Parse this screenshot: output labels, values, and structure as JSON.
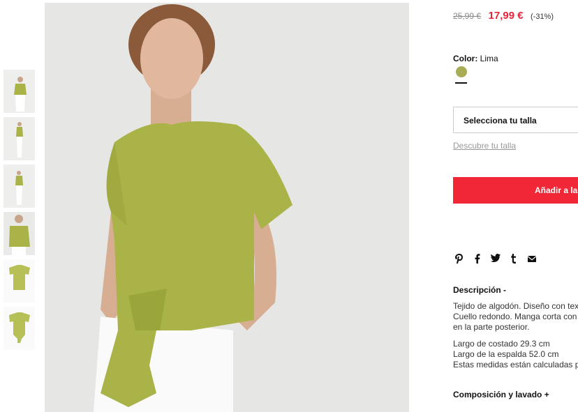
{
  "product": {
    "old_price": "25,99 €",
    "new_price": "17,99 €",
    "discount": "(-31%)",
    "color_label": "Color:",
    "color_value": "Lima",
    "swatch_color": "#a8ad54"
  },
  "size": {
    "select_label": "Selecciona tu talla",
    "guide_link": "Descubre tu talla"
  },
  "cart": {
    "add_label": "Añadir a la"
  },
  "share": {
    "icons": [
      "pinterest-icon",
      "facebook-icon",
      "twitter-icon",
      "tumblr-icon",
      "email-icon"
    ]
  },
  "description": {
    "title": "Descripción -",
    "line1": "Tejido de algodón. Diseño con tex",
    "line2": "Cuello redondo. Manga corta con",
    "line3": "en la parte posterior.",
    "line4": "Largo de costado 29.3 cm",
    "line5": "Largo de la espalda 52.0 cm",
    "line6": "Estas medidas están calculadas pa"
  },
  "composition": {
    "title": "Composición y lavado +"
  },
  "colors": {
    "accent": "#f12636",
    "price": "#e8233a",
    "product": "#a8ad54"
  }
}
